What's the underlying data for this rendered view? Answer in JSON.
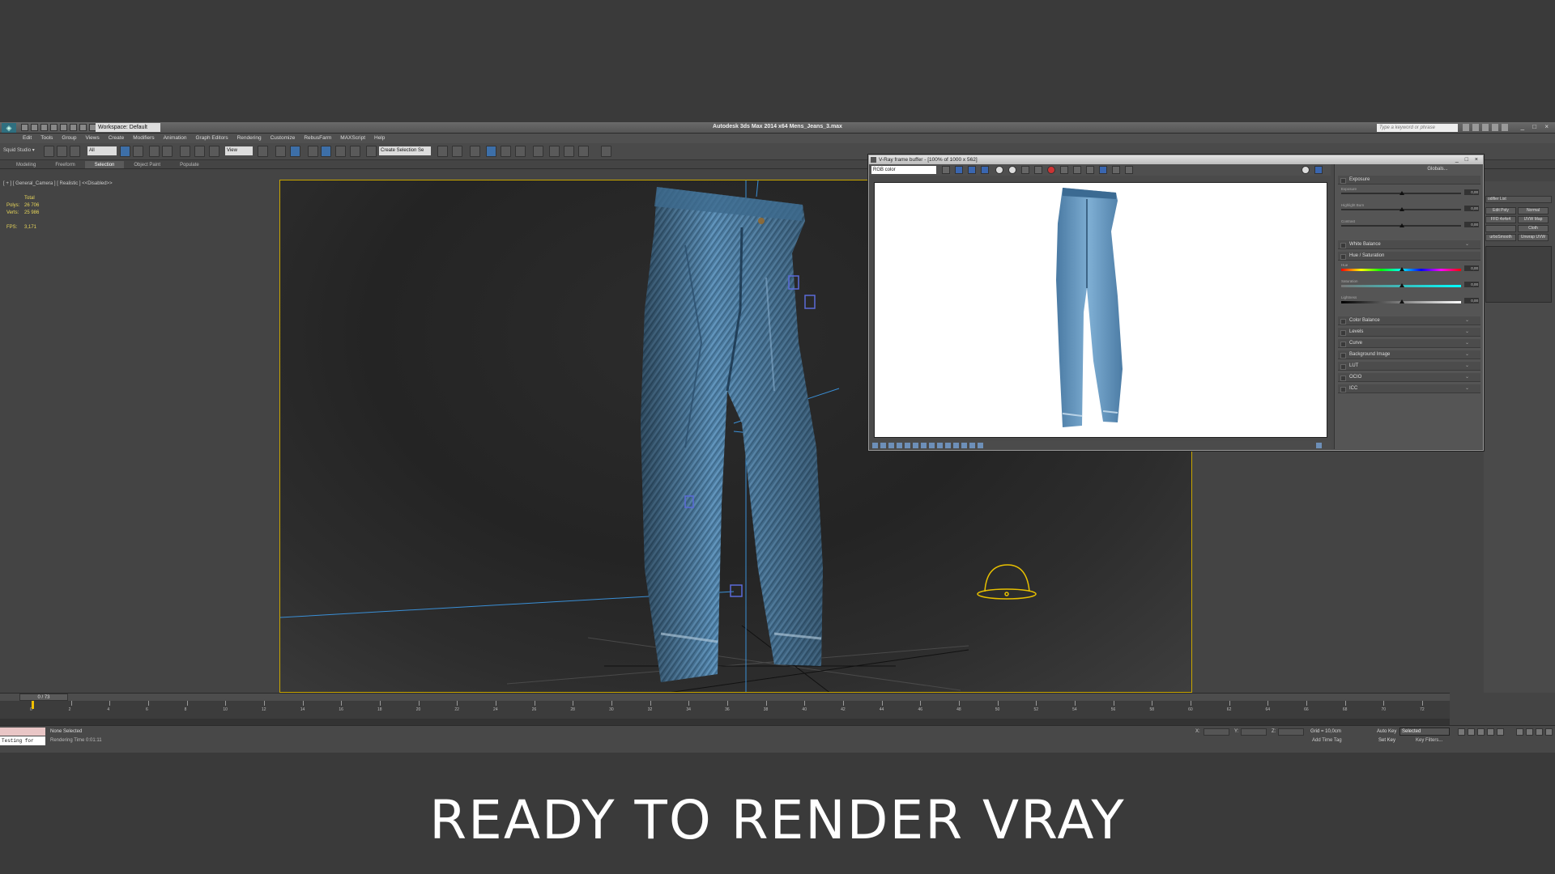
{
  "app": {
    "title": "Autodesk 3ds Max  2014 x64      Mens_Jeans_3.max",
    "workspace": "Workspace: Default",
    "search_placeholder": "Type a keyword or phrase",
    "window_controls": "_ □ ×"
  },
  "menu": [
    "Edit",
    "Tools",
    "Group",
    "Views",
    "Create",
    "Modifiers",
    "Animation",
    "Graph Editors",
    "Rendering",
    "Customize",
    "RebusFarm",
    "MAXScript",
    "Help"
  ],
  "toolbar": {
    "studio": "Squid Studio ▾",
    "filter": "All",
    "coord_system": "View",
    "selection_set": "Create Selection Se"
  },
  "ribbon_tabs": [
    {
      "label": "Modeling",
      "active": false
    },
    {
      "label": "Freeform",
      "active": false
    },
    {
      "label": "Selection",
      "active": true
    },
    {
      "label": "Object Paint",
      "active": false
    },
    {
      "label": "Populate",
      "active": false
    }
  ],
  "viewport": {
    "label": "[ + ] [ General_Camera ] [ Realistic ]  <<Disabled>>",
    "stats_header": "Total",
    "polys_label": "Polys:",
    "polys_value": "26 706",
    "verts_label": "Verts:",
    "verts_value": "25 986",
    "fps_label": "FPS:",
    "fps_value": "3,171"
  },
  "timeline": {
    "frame_display": "0 / 73",
    "current_frame": 0,
    "ticks": [
      0,
      2,
      4,
      6,
      8,
      10,
      12,
      14,
      16,
      18,
      20,
      22,
      24,
      26,
      28,
      30,
      32,
      34,
      36,
      38,
      40,
      42,
      44,
      46,
      48,
      50,
      52,
      54,
      56,
      58,
      60,
      62,
      64,
      66,
      68,
      70,
      72
    ]
  },
  "status": {
    "script_text": "Testing for",
    "selection": "None Selected",
    "render_time": "Rendering Time  0:01:11",
    "grid": "Grid = 10,0cm",
    "add_time_tag": "Add Time Tag",
    "auto_key": "Auto Key",
    "set_key": "Set Key",
    "key_mode": "Selected",
    "key_filters": "Key Filters...",
    "coord_x": "X:",
    "coord_y": "Y:",
    "coord_z": "Z:"
  },
  "command_panel": {
    "modifier_list": "odifier List",
    "buttons": [
      "Edit Poly",
      "Normal",
      "FFD 4x4x4",
      "UVW Map",
      "",
      "Cloth",
      "urboSmooth",
      "Unwrap UVW"
    ]
  },
  "vfb": {
    "title": "V-Ray frame buffer - [100% of 1000 x 562]",
    "channel": "RGB color",
    "globals": "Globals...",
    "sections": [
      {
        "label": "Exposure"
      },
      {
        "label": "White Balance"
      },
      {
        "label": "Hue / Saturation"
      },
      {
        "label": "Color Balance"
      },
      {
        "label": "Levels"
      },
      {
        "label": "Curve"
      },
      {
        "label": "Background Image"
      },
      {
        "label": "LUT"
      },
      {
        "label": "OCIO"
      },
      {
        "label": "ICC"
      }
    ],
    "exposure_sliders": [
      {
        "label": "Exposure",
        "value": "0,00"
      },
      {
        "label": "Highlight Burn",
        "value": "0,00"
      },
      {
        "label": "Contrast",
        "value": "0,00"
      }
    ],
    "hue_sliders": [
      {
        "label": "Hue",
        "value": "0,00"
      },
      {
        "label": "Saturation",
        "value": "0,00"
      },
      {
        "label": "Lightness",
        "value": "0,00"
      }
    ]
  },
  "colors": {
    "viewport_border": "#c9a600",
    "denim_light": "#6a9ec6",
    "denim_dark": "#2b4e6e",
    "stats_text": "#e8d65a",
    "helper_yellow": "#e8c000"
  },
  "caption": "READY TO RENDER  VRAY"
}
